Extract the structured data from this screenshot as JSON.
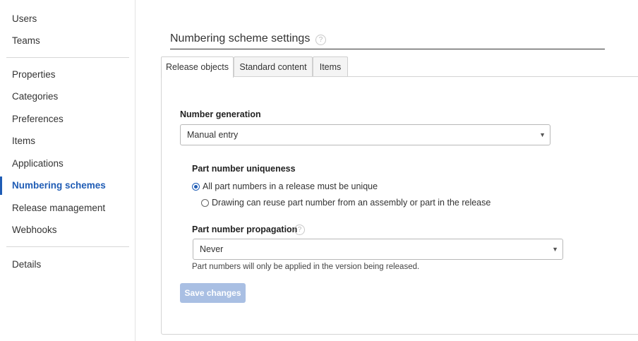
{
  "sidebar": {
    "items": [
      {
        "label": "Users"
      },
      {
        "label": "Teams"
      },
      {
        "label": "Properties"
      },
      {
        "label": "Categories"
      },
      {
        "label": "Preferences"
      },
      {
        "label": "Items"
      },
      {
        "label": "Applications"
      },
      {
        "label": "Numbering schemes",
        "active": true
      },
      {
        "label": "Release management"
      },
      {
        "label": "Webhooks"
      },
      {
        "label": "Details"
      }
    ]
  },
  "main": {
    "title": "Numbering scheme settings",
    "help_icon_glyph": "?",
    "tabs": [
      {
        "label": "Release objects",
        "active": true
      },
      {
        "label": "Standard content"
      },
      {
        "label": "Items"
      }
    ],
    "number_generation": {
      "label": "Number generation",
      "value": "Manual entry",
      "caret": "▼"
    },
    "uniqueness": {
      "label": "Part number uniqueness",
      "options": [
        {
          "label": "All part numbers in a release must be unique",
          "checked": true
        },
        {
          "label": "Drawing can reuse part number from an assembly or part in the release",
          "checked": false
        }
      ]
    },
    "propagation": {
      "label": "Part number propagation",
      "value": "Never",
      "caret": "▼",
      "hint": "Part numbers will only be applied in the version being released."
    },
    "save_label": "Save changes"
  },
  "colors": {
    "accent": "#1f5cb5",
    "button_disabled": "#a9bfe3"
  },
  "icons": [
    "help-circle-icon",
    "chevron-down-icon",
    "radio-icon"
  ]
}
